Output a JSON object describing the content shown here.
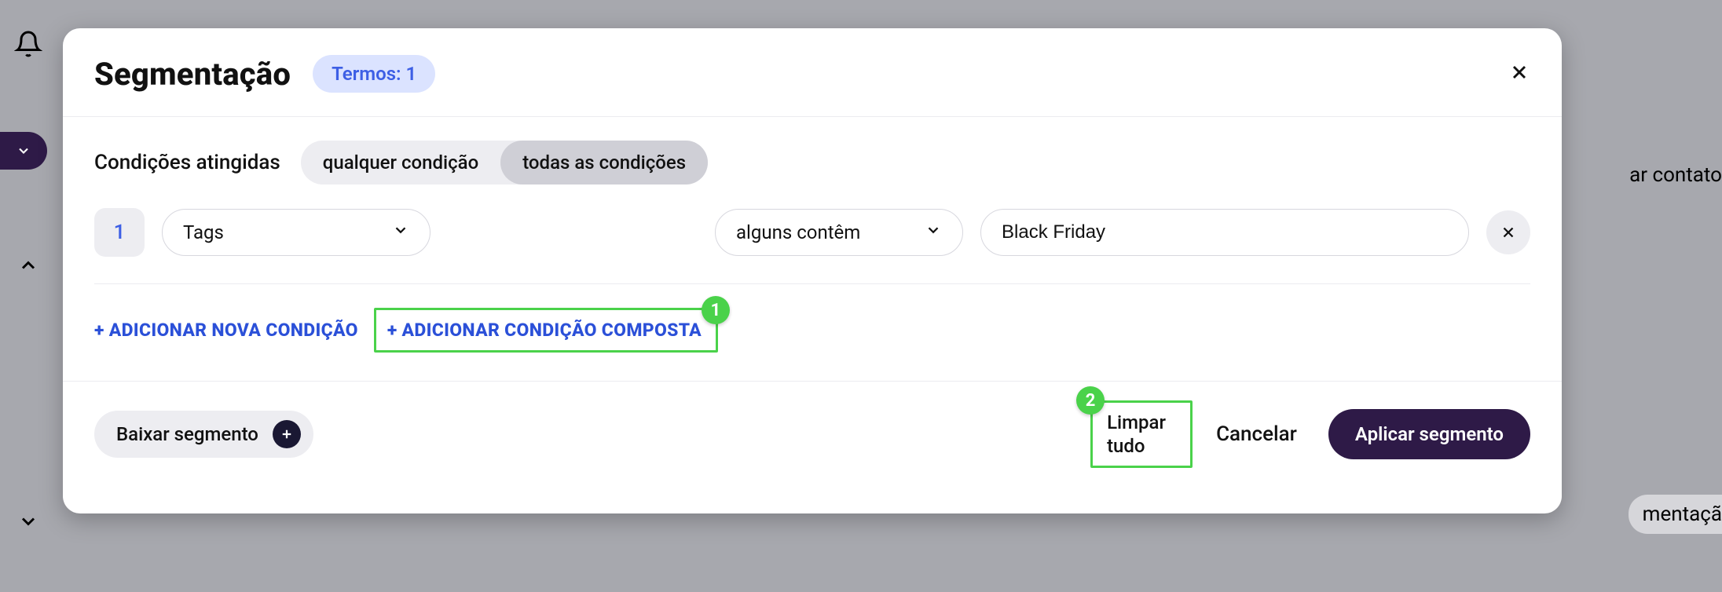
{
  "header": {
    "title": "Segmentação",
    "terms_label": "Termos: 1"
  },
  "conditions": {
    "section_label": "Condições atingidas",
    "toggle": {
      "option_any": "qualquer condição",
      "option_all": "todas as condições",
      "selected": "all"
    },
    "rows": [
      {
        "index": "1",
        "field": "Tags",
        "operator": "alguns contêm",
        "value": "Black Friday"
      }
    ],
    "add_simple_label": "+ ADICIONAR NOVA CONDIÇÃO",
    "add_compound_label": "+ ADICIONAR CONDIÇÃO COMPOSTA"
  },
  "footer": {
    "download_label": "Baixar segmento",
    "clear_label": "Limpar tudo",
    "cancel_label": "Cancelar",
    "apply_label": "Aplicar segmento"
  },
  "callouts": {
    "one": "1",
    "two": "2"
  },
  "background": {
    "right_top_text": "ar contato",
    "right_bottom_text": "mentaçã"
  }
}
